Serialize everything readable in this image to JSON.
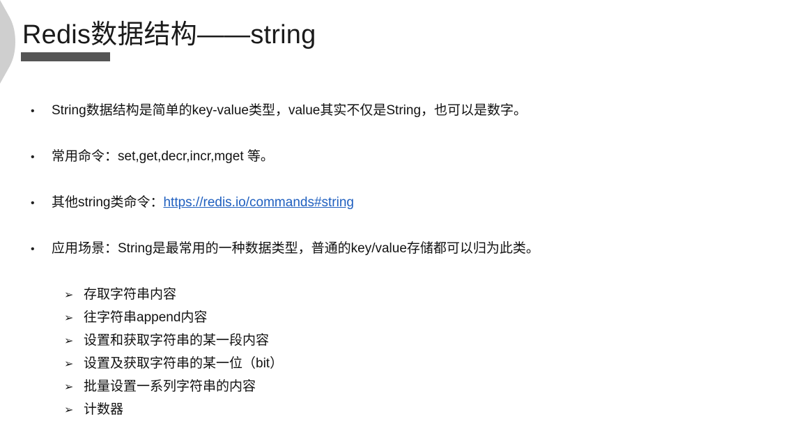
{
  "slide": {
    "title": "Redis数据结构——string"
  },
  "icons": {
    "bullet": "•",
    "sub_bullet": "➢"
  },
  "bullets": [
    {
      "text": "String数据结构是简单的key-value类型，value其实不仅是String，也可以是数字。"
    },
    {
      "text": "常用命令：set,get,decr,incr,mget 等。"
    },
    {
      "prefix": "其他string类命令：",
      "link": "https://redis.io/commands#string"
    },
    {
      "text": "应用场景：String是最常用的一种数据类型，普通的key/value存储都可以归为此类。"
    }
  ],
  "sub_items": [
    "存取字符串内容",
    "往字符串append内容",
    "设置和获取字符串的某一段内容",
    "设置及获取字符串的某一位（bit）",
    "批量设置一系列字符串的内容",
    "计数器"
  ],
  "colors": {
    "link": "#1f5fbf",
    "title_bar": "#555555",
    "corner": "#c8c8c8"
  }
}
